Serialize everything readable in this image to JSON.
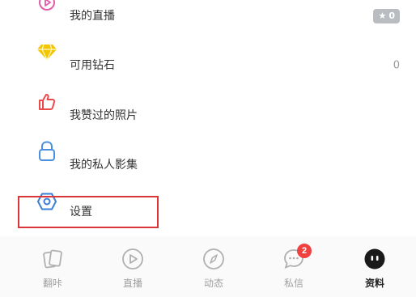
{
  "menu": {
    "live": {
      "label": "我的直播",
      "badge": "0"
    },
    "diamonds": {
      "label": "可用钻石",
      "count": "0"
    },
    "liked": {
      "label": "我赞过的照片"
    },
    "private": {
      "label": "我的私人影集"
    },
    "settings": {
      "label": "设置"
    }
  },
  "tabbar": {
    "tabs": [
      {
        "label": "翻咔",
        "icon": "cards-icon"
      },
      {
        "label": "直播",
        "icon": "play-icon"
      },
      {
        "label": "动态",
        "icon": "compass-icon"
      },
      {
        "label": "私信",
        "icon": "chat-icon",
        "badge": "2"
      },
      {
        "label": "资料",
        "icon": "profile-icon",
        "active": true
      }
    ]
  },
  "colors": {
    "live_icon": "#e15da8",
    "diamond_icon": "#f2c500",
    "like_icon": "#e94b4b",
    "lock_icon": "#4a8fe0",
    "settings_icon": "#3a7fd6",
    "highlight_border": "#d9373a",
    "badge_red": "#f04141"
  }
}
